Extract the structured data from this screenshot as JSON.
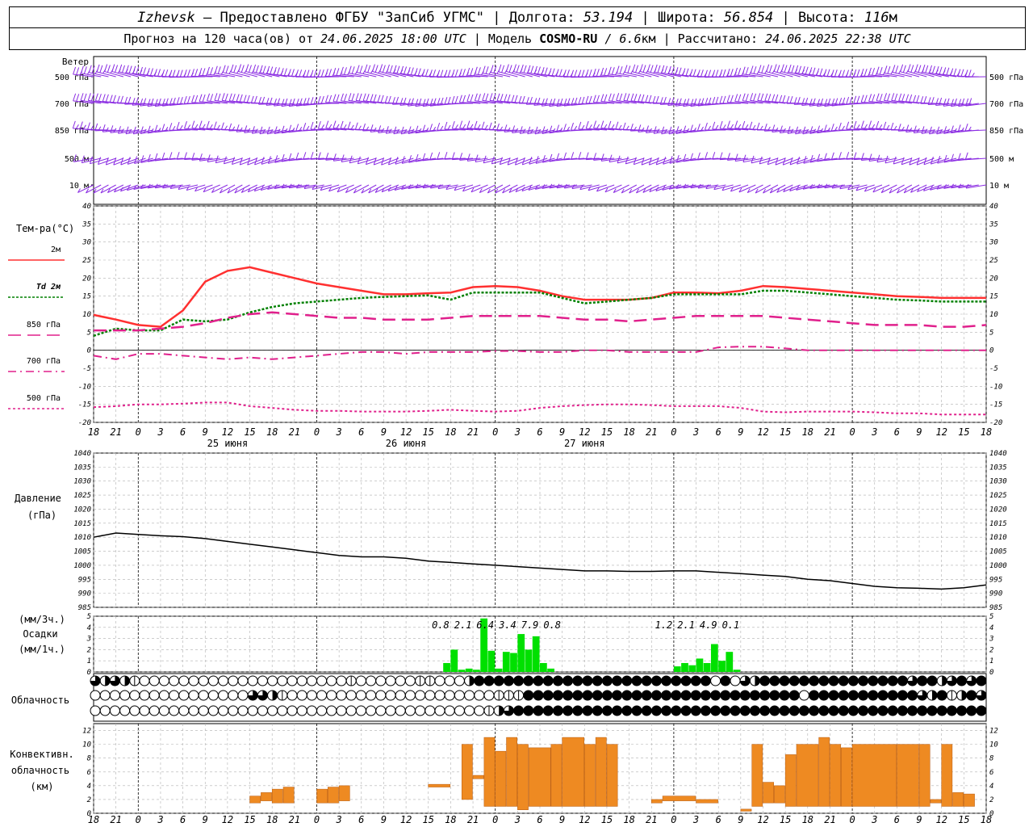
{
  "header": {
    "city": "Izhevsk",
    "provided": "– Предоставлено ФГБУ \"ЗапСиб УГМС\" | Долгота:",
    "lon": "53.194",
    "lat_label": "| Широта:",
    "lat": "56.854",
    "alt_label": "| Высота:",
    "alt": "116",
    "alt_unit": "м",
    "forecast_label": "Прогноз на 120 часа(ов) от",
    "forecast_date": "24.06.2025 18:00 UTC",
    "model_label": " | Модель",
    "model": "COSMO-RU",
    "model_res": "/ 6.6",
    "model_res_unit": "км",
    "calc_label": "| Рассчитано:",
    "calc_date": "24.06.2025 22:38 UTC"
  },
  "labels": {
    "wind": "Ветер",
    "wind_levels": [
      "500 гПа",
      "700 гПа",
      "850 гПа",
      "500 м",
      "10 м"
    ],
    "temp_title": "Тем-ра(°C)",
    "temp_legend": [
      "2м",
      "Td 2м",
      "850 гПа",
      "700 гПа",
      "500 гПа"
    ],
    "pressure_title": "Давление",
    "pressure_unit": "(гПа)",
    "precip_top": "(мм/3ч.)",
    "precip_mid": "Осадки",
    "precip_bot": "(мм/1ч.)",
    "clouds": "Облачность",
    "conv_1": "Конвективн.",
    "conv_2": "облачность",
    "conv_3": "(км)"
  },
  "colors": {
    "t2m": "#ff3030",
    "td2m": "#008000",
    "levels": "#e0208c",
    "wind": "#8a2be2",
    "precip": "#00e000",
    "conv": "#ee8a22"
  },
  "chart_data": [
    {
      "type": "line",
      "name": "temperature",
      "x_hours": [
        0,
        3,
        6,
        9,
        12,
        15,
        18,
        21,
        24,
        27,
        30,
        33,
        36,
        39,
        42,
        45,
        48,
        51,
        54,
        57,
        60,
        63,
        66,
        69,
        72,
        75,
        78,
        81,
        84,
        87,
        90,
        93,
        96,
        99,
        102,
        105,
        108,
        111,
        114,
        117,
        120
      ],
      "x_tick_labels": [
        "18",
        "21",
        "0",
        "3",
        "6",
        "9",
        "12",
        "15",
        "18",
        "21",
        "0",
        "3",
        "6",
        "9",
        "12",
        "15",
        "18",
        "21",
        "0",
        "3",
        "6",
        "9",
        "12",
        "15",
        "18",
        "21",
        "0",
        "3",
        "6",
        "9",
        "12",
        "15",
        "18",
        "21",
        "0",
        "3",
        "6",
        "9",
        "12",
        "15",
        "18",
        "21",
        "0"
      ],
      "day_labels": [
        {
          "hour": 18,
          "text": "25 июня"
        },
        {
          "hour": 42,
          "text": "26 июня"
        },
        {
          "hour": 66,
          "text": "27 июня"
        }
      ],
      "ylim": [
        -20,
        40
      ],
      "yticks": [
        -20,
        -15,
        -10,
        -5,
        0,
        5,
        10,
        15,
        20,
        25,
        30,
        35,
        40
      ],
      "series": [
        {
          "name": "2м",
          "values": [
            9.8,
            8.5,
            7.0,
            6.5,
            11.0,
            19.0,
            22.0,
            23.0,
            21.5,
            20.0,
            18.5,
            17.5,
            16.5,
            15.5,
            15.5,
            15.8,
            16.0,
            17.5,
            17.8,
            17.5,
            16.5,
            15.0,
            14.0,
            14.0,
            14.0,
            14.5,
            16.0,
            16.0,
            15.8,
            16.5,
            17.8,
            17.5,
            17.0,
            16.5,
            16.0,
            15.5,
            15.0,
            14.8,
            14.5,
            14.5,
            14.5
          ]
        },
        {
          "name": "Td 2м",
          "values": [
            4.0,
            6.0,
            5.5,
            5.5,
            8.5,
            8.0,
            8.5,
            10.5,
            12.0,
            13.0,
            13.5,
            14.0,
            14.5,
            14.8,
            15.0,
            15.2,
            14.0,
            16.0,
            16.0,
            16.0,
            16.0,
            14.5,
            13.0,
            13.5,
            14.0,
            14.5,
            15.5,
            15.5,
            15.5,
            15.5,
            16.5,
            16.5,
            16.0,
            15.5,
            15.0,
            14.5,
            14.0,
            13.8,
            13.5,
            13.5,
            13.5
          ]
        },
        {
          "name": "850 гПа",
          "values": [
            5.5,
            5.5,
            5.5,
            6.0,
            6.5,
            7.5,
            9.0,
            10.0,
            10.5,
            10.0,
            9.5,
            9.0,
            9.0,
            8.5,
            8.5,
            8.5,
            9.0,
            9.5,
            9.5,
            9.5,
            9.5,
            9.0,
            8.5,
            8.5,
            8.0,
            8.5,
            9.0,
            9.5,
            9.5,
            9.5,
            9.5,
            9.0,
            8.5,
            8.0,
            7.5,
            7.0,
            7.0,
            7.0,
            6.5,
            6.5,
            7.0
          ]
        },
        {
          "name": "700 гПа",
          "values": [
            -1.5,
            -2.5,
            -1.0,
            -1.0,
            -1.5,
            -2.0,
            -2.5,
            -2.0,
            -2.5,
            -2.0,
            -1.5,
            -1.0,
            -0.5,
            -0.5,
            -1.0,
            -0.5,
            -0.5,
            -0.5,
            -0.2,
            -0.2,
            -0.5,
            -0.5,
            0.0,
            0.0,
            -0.5,
            -0.5,
            -0.5,
            -0.5,
            0.8,
            1.0,
            1.0,
            0.5,
            0.0,
            0.0,
            0.0,
            0.0,
            0.0,
            0.0,
            0.0,
            0.0,
            0.0
          ]
        },
        {
          "name": "500 гПа",
          "values": [
            -15.8,
            -15.5,
            -15.0,
            -15.0,
            -14.8,
            -14.5,
            -14.5,
            -15.5,
            -16.0,
            -16.5,
            -16.8,
            -16.8,
            -17.0,
            -17.0,
            -17.0,
            -16.8,
            -16.5,
            -16.8,
            -17.0,
            -16.8,
            -16.0,
            -15.5,
            -15.2,
            -15.0,
            -15.0,
            -15.2,
            -15.5,
            -15.5,
            -15.5,
            -16.0,
            -17.0,
            -17.2,
            -17.0,
            -17.0,
            -17.0,
            -17.2,
            -17.5,
            -17.5,
            -17.8,
            -17.8,
            -17.8
          ]
        }
      ]
    },
    {
      "type": "line",
      "name": "pressure",
      "x_hours": [
        0,
        3,
        6,
        9,
        12,
        15,
        18,
        21,
        24,
        27,
        30,
        33,
        36,
        39,
        42,
        45,
        48,
        51,
        54,
        57,
        60,
        63,
        66,
        69,
        72,
        75,
        78,
        81,
        84,
        87,
        90,
        93,
        96,
        99,
        102,
        105,
        108,
        111,
        114,
        117,
        120
      ],
      "ylim": [
        985,
        1040
      ],
      "yticks": [
        985,
        990,
        995,
        1000,
        1005,
        1010,
        1015,
        1020,
        1025,
        1030,
        1035,
        1040
      ],
      "values": [
        1010.0,
        1011.5,
        1011.0,
        1010.5,
        1010.2,
        1009.5,
        1008.5,
        1007.5,
        1006.5,
        1005.5,
        1004.5,
        1003.5,
        1003.0,
        1003.0,
        1002.5,
        1001.5,
        1001.0,
        1000.5,
        1000.0,
        999.5,
        999.0,
        998.5,
        998.0,
        998.0,
        997.8,
        997.8,
        998.0,
        998.0,
        997.5,
        997.0,
        996.5,
        996.0,
        995.0,
        994.5,
        993.5,
        992.5,
        992.0,
        991.8,
        991.5,
        992.0,
        993.0
      ]
    },
    {
      "type": "bar",
      "name": "precipitation",
      "ylim": [
        0,
        5
      ],
      "yticks": [
        0,
        1,
        2,
        3,
        4,
        5
      ],
      "bars": [
        {
          "hour": 47,
          "value": 0.8
        },
        {
          "hour": 48,
          "value": 2.0
        },
        {
          "hour": 49,
          "value": 0.2
        },
        {
          "hour": 50,
          "value": 0.3
        },
        {
          "hour": 51,
          "value": 0.2
        },
        {
          "hour": 52,
          "value": 4.8
        },
        {
          "hour": 53,
          "value": 1.9
        },
        {
          "hour": 54,
          "value": 0.3
        },
        {
          "hour": 55,
          "value": 1.8
        },
        {
          "hour": 56,
          "value": 1.7
        },
        {
          "hour": 57,
          "value": 3.4
        },
        {
          "hour": 58,
          "value": 2.0
        },
        {
          "hour": 59,
          "value": 3.2
        },
        {
          "hour": 60,
          "value": 0.8
        },
        {
          "hour": 61,
          "value": 0.3
        },
        {
          "hour": 78,
          "value": 0.5
        },
        {
          "hour": 79,
          "value": 0.8
        },
        {
          "hour": 80,
          "value": 0.6
        },
        {
          "hour": 81,
          "value": 1.2
        },
        {
          "hour": 82,
          "value": 0.8
        },
        {
          "hour": 83,
          "value": 2.5
        },
        {
          "hour": 84,
          "value": 1.0
        },
        {
          "hour": 85,
          "value": 1.8
        },
        {
          "hour": 86,
          "value": 0.2
        }
      ],
      "totals_3h": [
        {
          "hour": 46,
          "text": "0.8"
        },
        {
          "hour": 49,
          "text": "2.1"
        },
        {
          "hour": 52,
          "text": "6.4"
        },
        {
          "hour": 55,
          "text": "3.4"
        },
        {
          "hour": 58,
          "text": "7.9"
        },
        {
          "hour": 61,
          "text": "0.8"
        },
        {
          "hour": 76,
          "text": "1.2"
        },
        {
          "hour": 79,
          "text": "2.1"
        },
        {
          "hour": 82,
          "text": "4.9"
        },
        {
          "hour": 85,
          "text": "0.1"
        }
      ]
    },
    {
      "type": "table",
      "name": "cloudiness",
      "rows": [
        "3232100000000000000000000010000001100024444444444444444444444440403244444444444444434423434",
        "0000000000000000332100000000000000000000011144444444444444444444444444440444444444443241243",
        "0000000000000000000000000000000000000000123444444444444444444444444444444444444444444444444"
      ]
    },
    {
      "type": "bar",
      "name": "convective_cloudiness",
      "ylim": [
        0,
        13
      ],
      "yticks": [
        0,
        2,
        4,
        6,
        8,
        10,
        12
      ],
      "bars": [
        {
          "start": 14,
          "end": 15,
          "bottom": 1.5,
          "top": 2.5
        },
        {
          "start": 15,
          "end": 16,
          "bottom": 1.8,
          "top": 3.0
        },
        {
          "start": 16,
          "end": 17,
          "bottom": 1.5,
          "top": 3.5
        },
        {
          "start": 17,
          "end": 18,
          "bottom": 1.5,
          "top": 3.8
        },
        {
          "start": 20,
          "end": 21,
          "bottom": 1.5,
          "top": 3.5
        },
        {
          "start": 21,
          "end": 22,
          "bottom": 1.5,
          "top": 3.8
        },
        {
          "start": 22,
          "end": 23,
          "bottom": 1.8,
          "top": 4.0
        },
        {
          "start": 30,
          "end": 32,
          "bottom": 3.8,
          "top": 4.2
        },
        {
          "start": 33,
          "end": 34,
          "bottom": 2.0,
          "top": 10.0
        },
        {
          "start": 34,
          "end": 35,
          "bottom": 5.0,
          "top": 5.5
        },
        {
          "start": 35,
          "end": 36,
          "bottom": 1.0,
          "top": 11.0
        },
        {
          "start": 36,
          "end": 37,
          "bottom": 1.0,
          "top": 9.0
        },
        {
          "start": 37,
          "end": 38,
          "bottom": 1.0,
          "top": 11.0
        },
        {
          "start": 38,
          "end": 39,
          "bottom": 0.5,
          "top": 10.0
        },
        {
          "start": 39,
          "end": 41,
          "bottom": 1.0,
          "top": 9.5
        },
        {
          "start": 41,
          "end": 42,
          "bottom": 1.0,
          "top": 10.0
        },
        {
          "start": 42,
          "end": 44,
          "bottom": 1.0,
          "top": 11.0
        },
        {
          "start": 44,
          "end": 45,
          "bottom": 1.0,
          "top": 10.0
        },
        {
          "start": 45,
          "end": 46,
          "bottom": 1.0,
          "top": 11.0
        },
        {
          "start": 46,
          "end": 47,
          "bottom": 1.0,
          "top": 10.0
        },
        {
          "start": 50,
          "end": 51,
          "bottom": 1.5,
          "top": 2.0
        },
        {
          "start": 51,
          "end": 54,
          "bottom": 1.8,
          "top": 2.5
        },
        {
          "start": 54,
          "end": 56,
          "bottom": 1.5,
          "top": 2.0
        },
        {
          "start": 58,
          "end": 59,
          "bottom": 0.3,
          "top": 0.6
        },
        {
          "start": 59,
          "end": 60,
          "bottom": 1.0,
          "top": 10.0
        },
        {
          "start": 60,
          "end": 61,
          "bottom": 1.5,
          "top": 4.5
        },
        {
          "start": 61,
          "end": 62,
          "bottom": 1.5,
          "top": 4.0
        },
        {
          "start": 62,
          "end": 63,
          "bottom": 1.0,
          "top": 8.5
        },
        {
          "start": 63,
          "end": 65,
          "bottom": 1.0,
          "top": 10.0
        },
        {
          "start": 65,
          "end": 66,
          "bottom": 1.0,
          "top": 11.0
        },
        {
          "start": 66,
          "end": 67,
          "bottom": 1.0,
          "top": 10.0
        },
        {
          "start": 67,
          "end": 68,
          "bottom": 1.0,
          "top": 9.5
        },
        {
          "start": 68,
          "end": 72,
          "bottom": 1.0,
          "top": 10.0
        },
        {
          "start": 72,
          "end": 74,
          "bottom": 1.0,
          "top": 10.0
        },
        {
          "start": 74,
          "end": 75,
          "bottom": 1.0,
          "top": 10.0
        },
        {
          "start": 75,
          "end": 76,
          "bottom": 1.5,
          "top": 2.0
        },
        {
          "start": 76,
          "end": 77,
          "bottom": 1.0,
          "top": 10.0
        },
        {
          "start": 77,
          "end": 78,
          "bottom": 1.0,
          "top": 3.0
        },
        {
          "start": 78,
          "end": 79,
          "bottom": 1.0,
          "top": 2.8
        }
      ]
    },
    {
      "type": "table",
      "name": "wind_barbs",
      "rows": [
        {
          "level": "500 гПа",
          "dir_deg": 282,
          "speed_ms": 24
        },
        {
          "level": "700 гПа",
          "dir_deg": 270,
          "speed_ms": 20
        },
        {
          "level": "850 гПа",
          "dir_deg": 265,
          "speed_ms": 14
        },
        {
          "level": "500 м",
          "dir_deg": 250,
          "speed_ms": 12
        },
        {
          "level": "10 м",
          "dir_deg": 240,
          "speed_ms": 5
        }
      ]
    }
  ]
}
